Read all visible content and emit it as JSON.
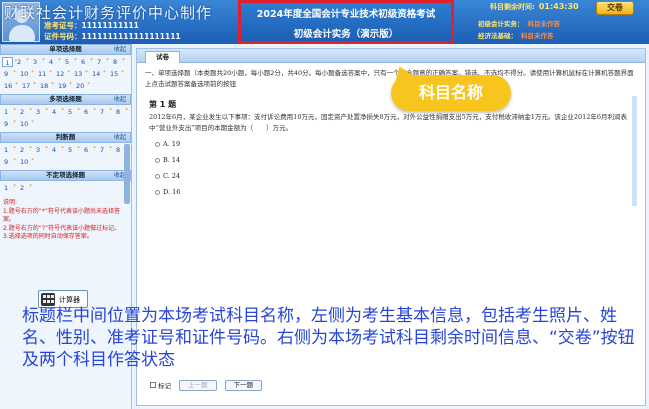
{
  "header": {
    "watermark": "财联社会计财务评价中心制作",
    "candidate": {
      "ticket_label": "准考证号：",
      "ticket_value": "11111111111",
      "id_label": "证件号码：",
      "id_value": "1111111111111111111"
    },
    "exam_title_line1": "2024年度全国会计专业技术初级资格考试",
    "exam_title_line2": "初级会计实务（演示版）",
    "remaining_time_label": "科目剩余时间:",
    "remaining_time": "01:43:30",
    "submit_label": "交卷",
    "subjects": [
      {
        "name": "初级会计实务：",
        "status": "科目未作答"
      },
      {
        "name": "经济法基础：",
        "status": "科目未作答"
      }
    ]
  },
  "left_panel": {
    "sections": [
      {
        "title": "单项选择题",
        "collapse": "收起",
        "numbers": [
          "1",
          "2",
          "3",
          "4",
          "5",
          "6",
          "7",
          "8",
          "9",
          "10",
          "11",
          "12",
          "13",
          "14",
          "15",
          "16",
          "17",
          "18",
          "19",
          "20"
        ]
      },
      {
        "title": "多项选择题",
        "collapse": "收起",
        "numbers": [
          "1",
          "2",
          "3",
          "4",
          "5",
          "6",
          "7",
          "8",
          "9",
          "10"
        ]
      },
      {
        "title": "判断题",
        "collapse": "收起",
        "numbers": [
          "1",
          "2",
          "3",
          "4",
          "5",
          "6",
          "7",
          "8",
          "9",
          "10"
        ]
      },
      {
        "title": "不定项选择题",
        "collapse": "收起",
        "numbers": [
          "1",
          "2"
        ]
      }
    ],
    "notes_label": "说明:",
    "notes": [
      "1.题号右方的“*”符号代表该小题尚未选择答案。",
      "2.题号右方的“?”符号代表该小题做过标记。",
      "3.选择选项的同时自动保存答案。"
    ],
    "calculator_label": "计算器"
  },
  "main": {
    "tab_label": "试卷",
    "instruction": "一、单项选择题（本类题共20小题，每小题2分，共40分。每小题备选答案中，只有一个符合题意的正确答案。错选、不选均不得分。请使用计算机鼠标在计算机答题界面上点击试题答案备选项前的按钮",
    "question_title": "第 1 题",
    "question_text": "2012年6月，某企业发生以下事项：支付诉讼费用10万元，固定资产处置净损失8万元，对外公益性捐赠支出5万元，支付税收滞纳金1万元。该企业2012年6月利润表中“营业外支出”项目的本期金额为（　　）万元。",
    "options": [
      "A. 19",
      "B. 14",
      "C. 24",
      "D. 16"
    ],
    "mark_label": "标记",
    "prev_label": "上一题",
    "next_label": "下一题"
  },
  "callout": "科目名称",
  "subtitle": "标题栏中间位置为本场考试科目名称，左侧为考生基本信息，包括考生照片、姓名、性别、准考证号和证件号码。右侧为本场考试科目剩余时间信息、“交卷”按钮及两个科目作答状态",
  "colors": {
    "header_blue": "#2370c8",
    "highlight_red": "#e0202a",
    "callout_yellow": "#f7c51d",
    "subtitle_blue": "#2745d7"
  }
}
